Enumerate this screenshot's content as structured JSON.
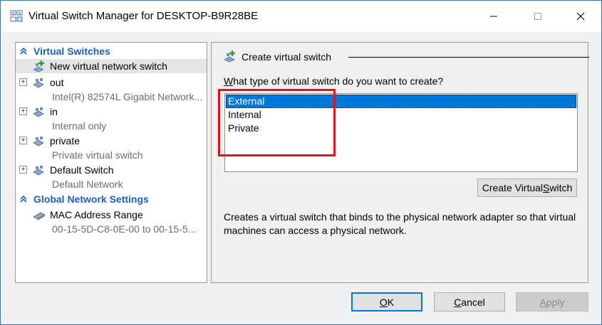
{
  "window": {
    "title": "Virtual Switch Manager for DESKTOP-B9R28BE"
  },
  "sidebar": {
    "virtual_switches_header": "Virtual Switches",
    "new_switch": "New virtual network switch",
    "switches": [
      {
        "name": "out",
        "detail": "Intel(R) 82574L Gigabit Network..."
      },
      {
        "name": "in",
        "detail": "Internal only"
      },
      {
        "name": "private",
        "detail": "Private virtual switch"
      },
      {
        "name": "Default Switch",
        "detail": "Default Network"
      }
    ],
    "global_header": "Global Network Settings",
    "mac_range": {
      "name": "MAC Address Range",
      "detail": "00-15-5D-C8-0E-00 to 00-15-5..."
    }
  },
  "main": {
    "section_title": "Create virtual switch",
    "question_prefix": "W",
    "question_rest": "hat type of virtual switch do you want to create?",
    "options": [
      "External",
      "Internal",
      "Private"
    ],
    "selected_option": "External",
    "create_button_prefix": "Create Virtual ",
    "create_button_underline": "S",
    "create_button_suffix": "witch",
    "description": "Creates a virtual switch that binds to the physical network adapter so that virtual machines can access a physical network."
  },
  "footer": {
    "ok_underline": "O",
    "ok_rest": "K",
    "cancel_underline": "C",
    "cancel_rest": "ancel",
    "apply_underline": "A",
    "apply_rest": "pply"
  },
  "colors": {
    "accent": "#0078d7",
    "section_header": "#1e5fb8",
    "highlight": "#e3121c"
  }
}
